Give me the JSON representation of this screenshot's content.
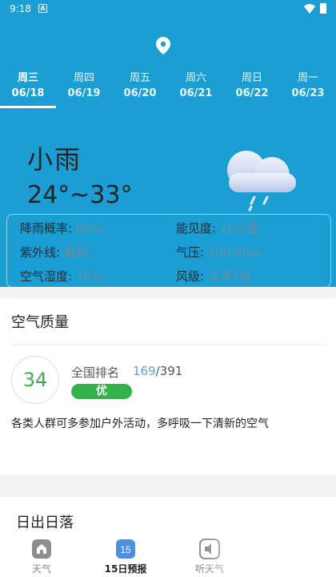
{
  "status_bar": {
    "time": "9:18",
    "notif": "A"
  },
  "day_tabs": [
    {
      "weekday": "周三",
      "date": "06/18",
      "active": true
    },
    {
      "weekday": "周四",
      "date": "06/19"
    },
    {
      "weekday": "周五",
      "date": "06/20"
    },
    {
      "weekday": "周六",
      "date": "06/21"
    },
    {
      "weekday": "周日",
      "date": "06/22"
    },
    {
      "weekday": "周一",
      "date": "06/23"
    }
  ],
  "weather": {
    "condition": "小雨",
    "temp_range": "24°~33°",
    "details": {
      "rain_prob_label": "降雨概率:",
      "rain_prob": "60%",
      "visibility_label": "能见度:",
      "visibility": "16公里",
      "uv_label": "紫外线:",
      "uv": "最弱",
      "pressure_label": "气压:",
      "pressure": "1003hpa",
      "humidity_label": "空气湿度:",
      "humidity": "76%",
      "wind_label": "风级:",
      "wind": "北风1级"
    }
  },
  "air_quality": {
    "title": "空气质量",
    "aqi": "34",
    "rank_label": "全国排名",
    "rank": "169",
    "rank_total": "/391",
    "level": "优",
    "advice": "各类人群可多参加户外活动，多呼吸一下清新的空气"
  },
  "sun": {
    "title": "日出日落"
  },
  "bottom_nav": {
    "weather_label": "天气",
    "forecast_label": "15日预报",
    "forecast_badge": "15",
    "listen_label": "听天气"
  },
  "colors": {
    "header_bg": "#1a9ed3",
    "aqi_good": "#35b14a",
    "rank_highlight": "#4da8e0"
  }
}
